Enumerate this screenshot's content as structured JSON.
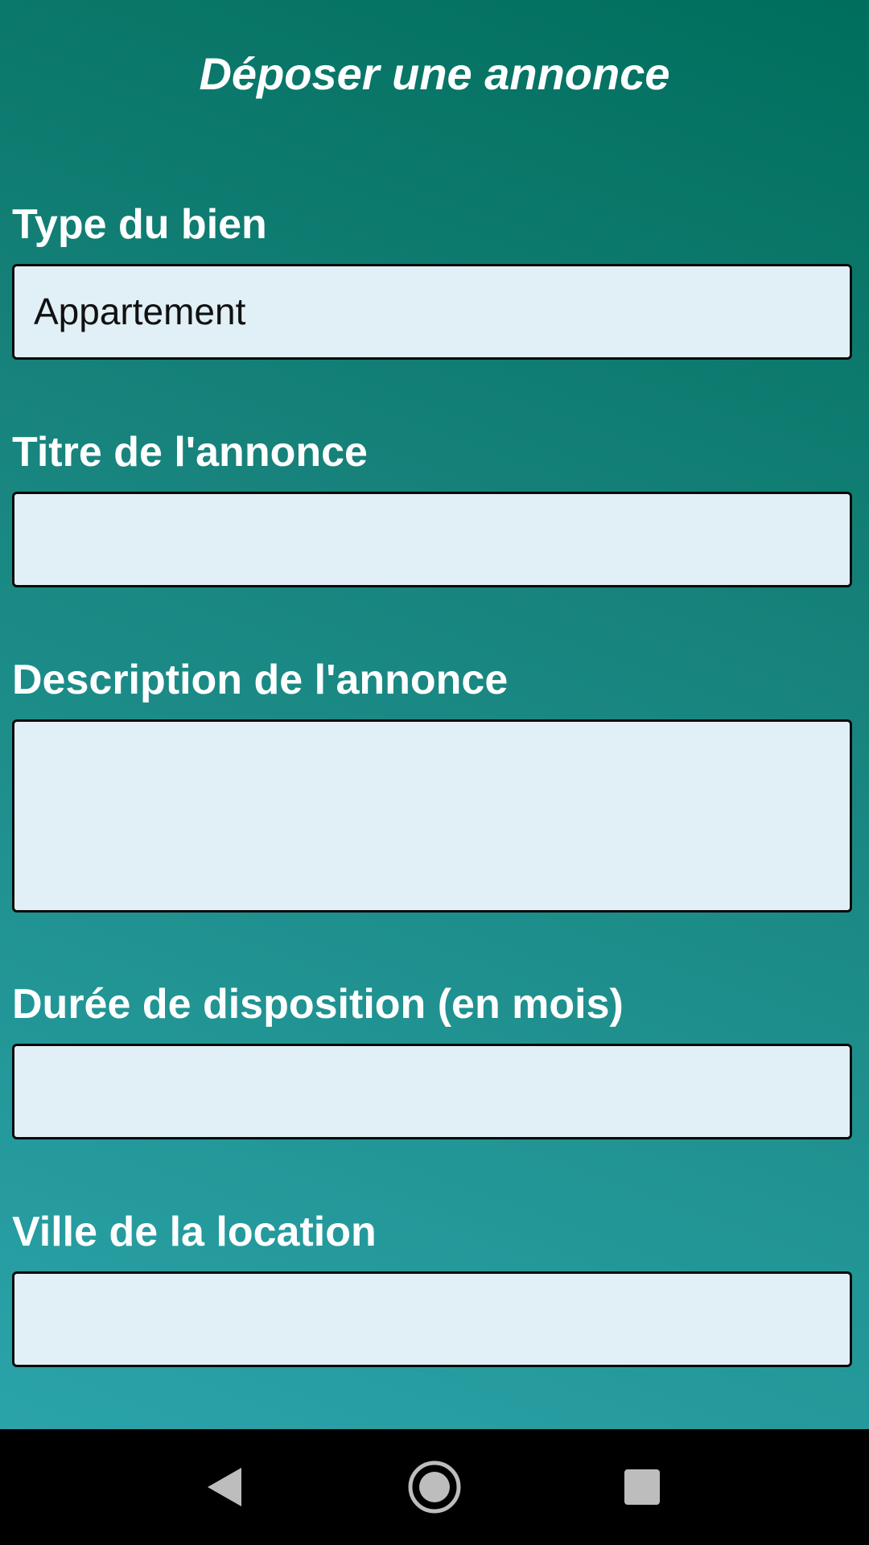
{
  "header": {
    "title": "Déposer une annonce"
  },
  "form": {
    "type_label": "Type du bien",
    "type_value": "Appartement",
    "titre_label": "Titre de l'annonce",
    "titre_value": "",
    "description_label": "Description de l'annonce",
    "description_value": "",
    "duree_label": "Durée de disposition (en mois)",
    "duree_value": "",
    "ville_label": "Ville de la location",
    "ville_value": ""
  },
  "navbar": {
    "back_icon": "back-triangle-icon",
    "home_icon": "home-circle-icon",
    "recents_icon": "recents-square-icon"
  },
  "colors": {
    "background_top": "#006e5c",
    "background_bottom": "#2aa3a9",
    "field_background": "#e1eff6",
    "navbar": "#000000"
  }
}
